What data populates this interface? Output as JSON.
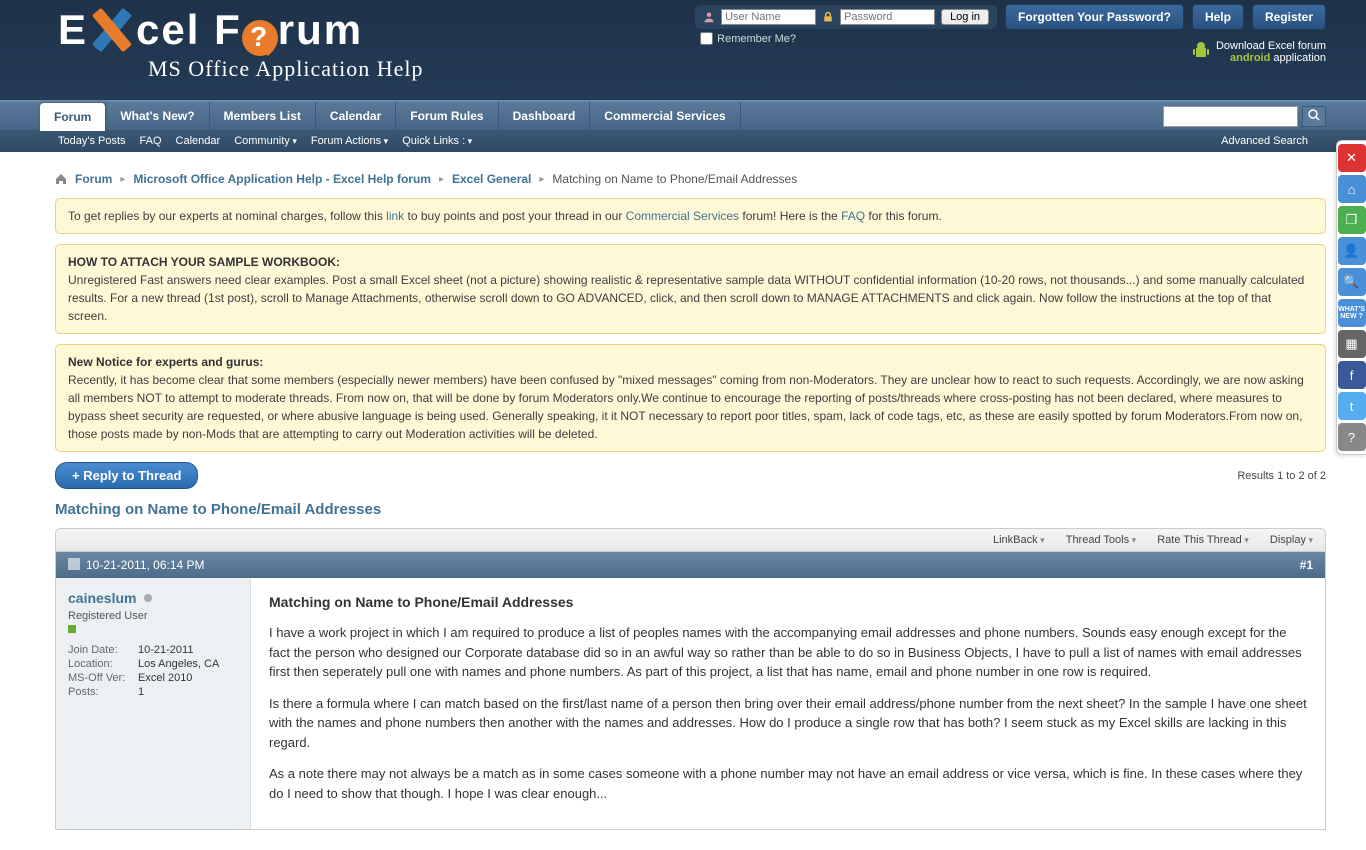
{
  "top": {
    "forgot": "Forgotten Your Password?",
    "help": "Help",
    "register": "Register",
    "username_ph": "User Name",
    "password_ph": "Password",
    "login": "Log in",
    "remember": "Remember Me?",
    "dl_line1": "Download Excel forum",
    "dl_line2a": "android",
    "dl_line2b": " application"
  },
  "logo": {
    "sub": "MS Office Application Help"
  },
  "nav": {
    "tabs": [
      "Forum",
      "What's New?",
      "Members List",
      "Calendar",
      "Forum Rules",
      "Dashboard",
      "Commercial Services"
    ],
    "sub": [
      "Today's Posts",
      "FAQ",
      "Calendar",
      "Community",
      "Forum Actions",
      "Quick Links"
    ],
    "adv": "Advanced Search"
  },
  "crumbs": {
    "c1": "Forum",
    "c2": "Microsoft Office Application Help - Excel Help forum",
    "c3": "Excel General",
    "cur": "Matching on Name to Phone/Email Addresses"
  },
  "n1": {
    "a": "To get replies by our experts at nominal charges, follow this ",
    "link": "link",
    "b": " to buy points and post your thread in our ",
    "cs": "Commercial Services",
    "c": " forum! Here is the ",
    "faq": "FAQ",
    "d": " for this forum."
  },
  "n2": {
    "h": "HOW TO ATTACH YOUR SAMPLE WORKBOOK:",
    "t": "Unregistered Fast answers need clear examples. Post a small Excel sheet (not a picture) showing realistic & representative sample data WITHOUT confidential information (10-20 rows, not thousands...) and some manually calculated results. For a new thread (1st post), scroll to Manage Attachments, otherwise scroll down to GO ADVANCED, click, and then scroll down to MANAGE ATTACHMENTS and click again. Now follow the instructions at the top of that screen."
  },
  "n3": {
    "h": "New Notice for experts and gurus:",
    "t": "Recently, it has become clear that some members (especially newer members) have been confused by \"mixed messages\" coming from non-Moderators. They are unclear how to react to such requests. Accordingly, we are now asking all members NOT to attempt to moderate threads. From now on, that will be done by forum Moderators only.We continue to encourage the reporting of posts/threads where cross-posting has not been declared, where measures to bypass sheet security are requested, or where abusive language is being used. Generally speaking, it it NOT necessary to report poor titles, spam, lack of code tags, etc, as these are easily spotted by forum Moderators.From now on, those posts made by non-Mods that are attempting to carry out Moderation activities will be deleted."
  },
  "reply": "Reply to Thread",
  "results": "Results 1 to 2 of 2",
  "thread_title": "Matching on Name to Phone/Email Addresses",
  "tools": {
    "a": "LinkBack",
    "b": "Thread Tools",
    "c": "Rate This Thread",
    "d": "Display"
  },
  "post": {
    "date": "10-21-2011, 06:14 PM",
    "num": "#1",
    "user": "caineslum",
    "utitle": "Registered User",
    "jd_l": "Join Date:",
    "jd_v": "10-21-2011",
    "loc_l": "Location:",
    "loc_v": "Los Angeles, CA",
    "ver_l": "MS-Off Ver:",
    "ver_v": "Excel 2010",
    "pc_l": "Posts:",
    "pc_v": "1",
    "title": "Matching on Name to Phone/Email Addresses",
    "p1": "I have a work project in which I am required to produce a list of peoples names with the accompanying email addresses and phone numbers. Sounds easy enough except for the fact the person who designed our Corporate database did so in an awful way so rather than be able to do so in Business Objects, I have to pull a list of names with email addresses first then seperately pull one with names and phone numbers. As part of this project, a list that has name, email and phone number in one row is required.",
    "p2": "Is there a formula where I can match based on the first/last name of a person then bring over their email address/phone number from the next sheet? In the sample I have one sheet with the names and phone numbers then another with the names and addresses. How do I produce a single row that has both? I seem stuck as my Excel skills are lacking in this regard.",
    "p3": "As a note there may not always be a match as in some cases someone with a phone number may not have an email address or vice versa, which is fine. In these cases where they do I need to show that though. I hope I was clear enough..."
  }
}
